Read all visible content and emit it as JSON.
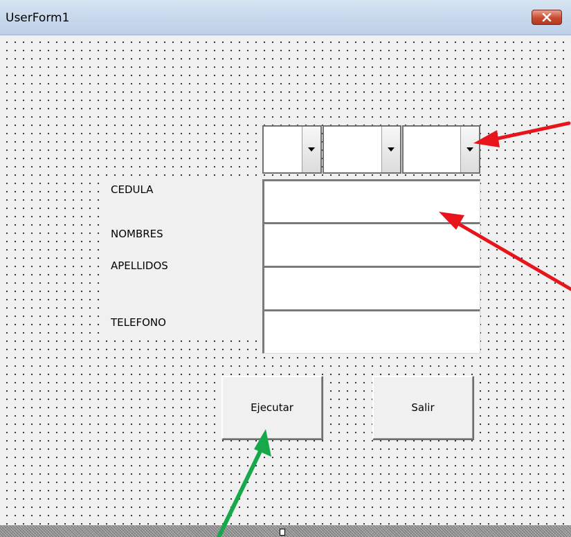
{
  "window": {
    "title": "UserForm1",
    "close_glyph": "x"
  },
  "form": {
    "labels": {
      "cedula": "CEDULA",
      "nombres": "NOMBRES",
      "apellidos": "APELLIDOS",
      "telefono": "TELEFONO"
    },
    "comboboxes": [
      {
        "value": ""
      },
      {
        "value": ""
      },
      {
        "value": ""
      }
    ],
    "textboxes": {
      "cedula": "",
      "nombres": "",
      "apellidos": "",
      "telefono": ""
    },
    "buttons": {
      "ejecutar": "Ejecutar",
      "salir": "Salir"
    }
  },
  "annotations": {
    "arrow_color_red": "#e8141b",
    "arrow_color_green": "#16a84a"
  },
  "colors": {
    "form_background": "#f0f0f0",
    "title_bar": "#c5d7ec",
    "close_button": "#c94a30"
  }
}
